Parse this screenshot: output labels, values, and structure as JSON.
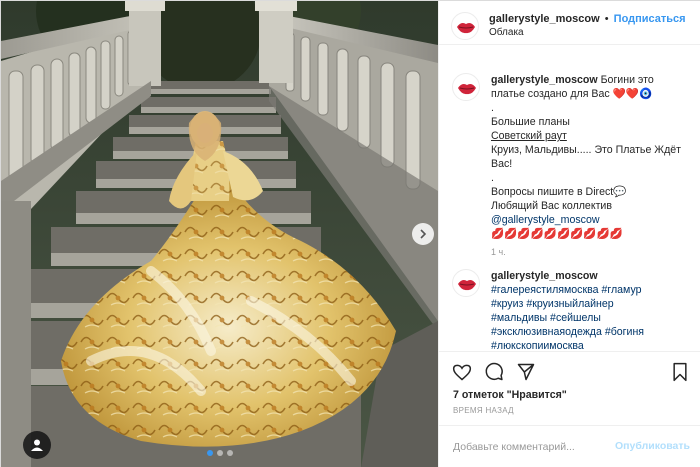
{
  "post": {
    "username": "gallerystyle_moscow",
    "separator": "•",
    "follow_label": "Подписаться",
    "location": "Облака"
  },
  "caption": {
    "username": "gallerystyle_moscow",
    "line1": "Богини это",
    "line2": "платье создано для Вас",
    "line3": "❤️❤️🧿",
    "line4": ".",
    "line5": "Большие планы",
    "line6": "Советский раут",
    "line7": "Круиз, Мальдивы..... Это Платье Ждёт",
    "line8": "Вас!",
    "line9": ".",
    "line10": "Вопросы пишите в Direct💬",
    "line11": "Любящий Вас коллектив",
    "line12": "@gallerystyle_moscow",
    "line13": "💋💋💋💋💋💋💋💋💋💋",
    "time": "1 ч."
  },
  "tags_comment": {
    "username": "gallerystyle_moscow",
    "tags": [
      "#галереястилямосква #гламур",
      "#круиз #круизныйлайнер",
      "#мальдивы #сейшелы",
      "#эксклюзивнаяодежда #богиня",
      "#люкскопиимосква"
    ]
  },
  "stats": {
    "likes": "7 отметок \"Нравится\"",
    "ago": "ВРЕМЯ НАЗАД"
  },
  "comment_box": {
    "placeholder": "Добавьте комментарий...",
    "publish_label": "Опубликовать"
  },
  "icons": {
    "like": "heart-icon",
    "comment": "comment-icon",
    "share": "share-icon",
    "save": "bookmark-icon",
    "tagged_user": "user-icon",
    "next": "chevron-right-icon"
  },
  "carousel": {
    "slides": 3,
    "active": 1
  },
  "colors": {
    "link": "#3897f0",
    "mention": "#003569",
    "muted": "#999999",
    "publish_disabled": "#b2dffc"
  }
}
